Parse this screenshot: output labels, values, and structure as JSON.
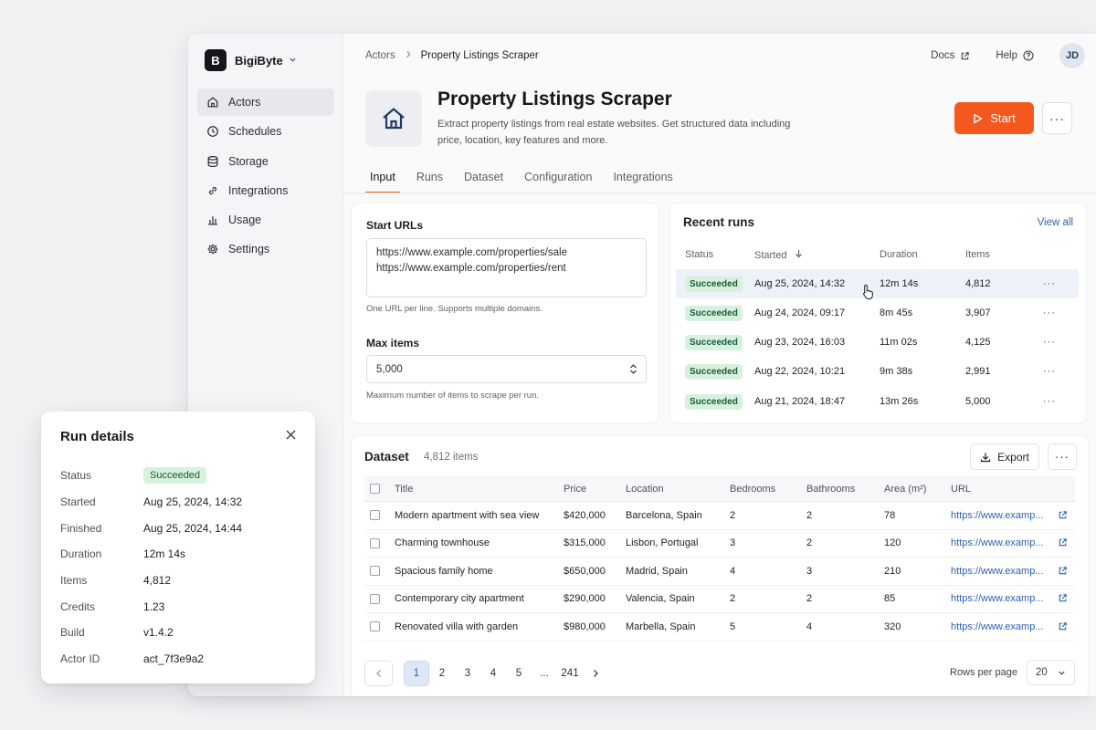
{
  "brand": {
    "name": "BigiByte",
    "logo_letter": "B"
  },
  "sidebar": {
    "items": [
      {
        "label": "Actors",
        "icon": "home-icon",
        "active": true
      },
      {
        "label": "Schedules",
        "icon": "clock-icon"
      },
      {
        "label": "Storage",
        "icon": "database-icon"
      },
      {
        "label": "Integrations",
        "icon": "link-icon"
      },
      {
        "label": "Usage",
        "icon": "bar-chart-icon"
      },
      {
        "label": "Settings",
        "icon": "gear-icon"
      }
    ]
  },
  "breadcrumb": {
    "parent": "Actors",
    "current": "Property Listings Scraper"
  },
  "top_links": {
    "docs": "Docs",
    "help": "Help",
    "avatar": "JD"
  },
  "actor": {
    "title": "Property Listings Scraper",
    "description": "Extract property listings from real estate websites. Get structured data including price, location, key features and more.",
    "start_label": "Start"
  },
  "tabs": [
    "Input",
    "Runs",
    "Dataset",
    "Configuration",
    "Integrations"
  ],
  "input": {
    "start_urls_label": "Start URLs",
    "start_urls": [
      "https://www.example.com/properties/sale",
      "https://www.example.com/properties/rent"
    ],
    "start_urls_help": "One URL per line. Supports multiple domains.",
    "max_items_label": "Max items",
    "max_items_value": "5,000",
    "max_items_help": "Maximum number of items to scrape per run."
  },
  "recent_runs": {
    "title": "Recent runs",
    "view_all": "View all",
    "columns": [
      "Status",
      "Started",
      "Duration",
      "Items"
    ],
    "rows": [
      {
        "status": "Succeeded",
        "started": "Aug 25, 2024, 14:32",
        "duration": "12m 14s",
        "items": "4,812"
      },
      {
        "status": "Succeeded",
        "started": "Aug 24, 2024, 09:17",
        "duration": "8m 45s",
        "items": "3,907"
      },
      {
        "status": "Succeeded",
        "started": "Aug 23, 2024, 16:03",
        "duration": "11m 02s",
        "items": "4,125"
      },
      {
        "status": "Succeeded",
        "started": "Aug 22, 2024, 10:21",
        "duration": "9m 38s",
        "items": "2,991"
      },
      {
        "status": "Succeeded",
        "started": "Aug 21, 2024, 18:47",
        "duration": "13m 26s",
        "items": "5,000"
      }
    ]
  },
  "dataset": {
    "title": "Dataset",
    "count": "4,812 items",
    "export_label": "Export",
    "columns": [
      "Title",
      "Price",
      "Location",
      "Bedrooms",
      "Bathrooms",
      "Area (m²)",
      "URL"
    ],
    "rows": [
      {
        "title": "Modern apartment with sea view",
        "price": "$420,000",
        "location": "Barcelona, Spain",
        "bedrooms": "2",
        "bathrooms": "2",
        "area": "78",
        "url": "https://www.examp..."
      },
      {
        "title": "Charming townhouse",
        "price": "$315,000",
        "location": "Lisbon, Portugal",
        "bedrooms": "3",
        "bathrooms": "2",
        "area": "120",
        "url": "https://www.examp..."
      },
      {
        "title": "Spacious family home",
        "price": "$650,000",
        "location": "Madrid, Spain",
        "bedrooms": "4",
        "bathrooms": "3",
        "area": "210",
        "url": "https://www.examp..."
      },
      {
        "title": "Contemporary city apartment",
        "price": "$290,000",
        "location": "Valencia, Spain",
        "bedrooms": "2",
        "bathrooms": "2",
        "area": "85",
        "url": "https://www.examp..."
      },
      {
        "title": "Renovated villa with garden",
        "price": "$980,000",
        "location": "Marbella, Spain",
        "bedrooms": "5",
        "bathrooms": "4",
        "area": "320",
        "url": "https://www.examp..."
      }
    ],
    "pagination": {
      "pages": [
        "1",
        "2",
        "3",
        "4",
        "5",
        "...",
        "241"
      ],
      "current": "1"
    },
    "rows_per_page_label": "Rows per page",
    "rows_per_page_value": "20"
  },
  "run_details": {
    "title": "Run details",
    "fields": [
      {
        "key": "Status",
        "value": "Succeeded"
      },
      {
        "key": "Started",
        "value": "Aug 25, 2024, 14:32"
      },
      {
        "key": "Finished",
        "value": "Aug 25, 2024, 14:44"
      },
      {
        "key": "Duration",
        "value": "12m 14s"
      },
      {
        "key": "Items",
        "value": "4,812"
      },
      {
        "key": "Credits",
        "value": "1.23"
      },
      {
        "key": "Build",
        "value": "v1.4.2"
      },
      {
        "key": "Actor ID",
        "value": "act_7f3e9a2"
      }
    ]
  },
  "colors": {
    "accent": "#f4581f",
    "link": "#2a5fb8",
    "success_bg": "#d6f2df",
    "success_text": "#1b5b30"
  }
}
